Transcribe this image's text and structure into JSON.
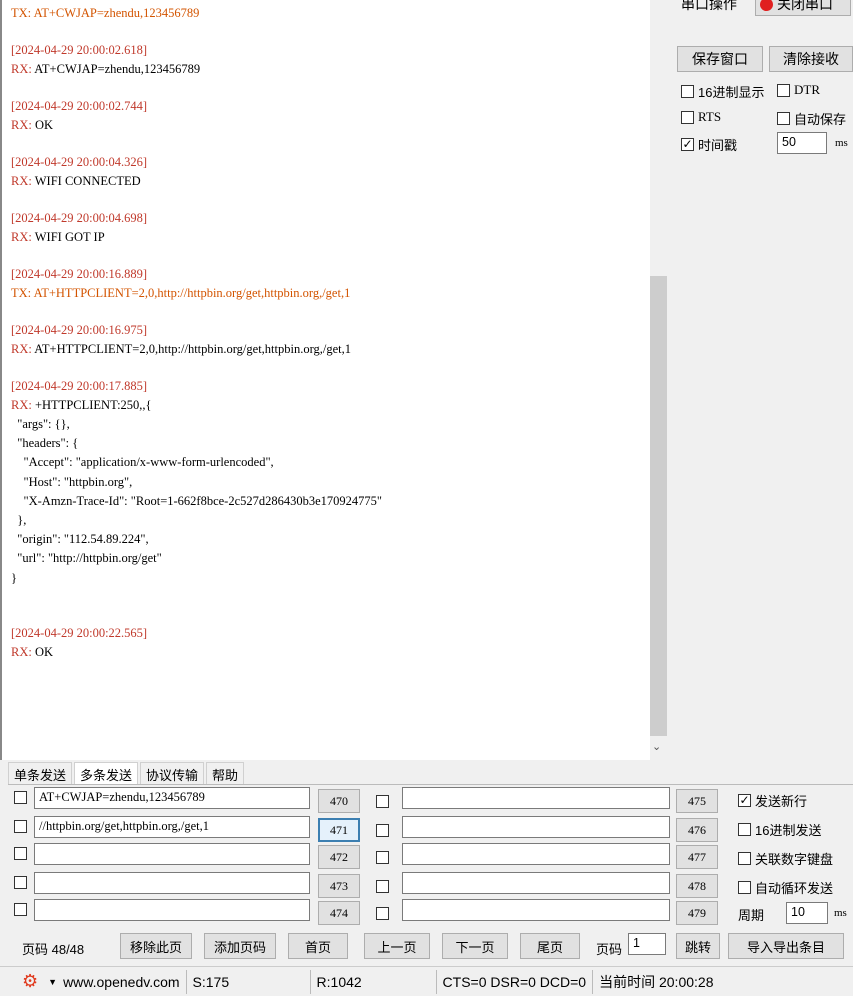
{
  "log": {
    "first_line": "TX: AT+CWJAP=zhendu,123456789",
    "entries": [
      {
        "ts": "[2024-04-29 20:00:02.618]",
        "prefix": "RX: ",
        "text": "AT+CWJAP=zhendu,123456789",
        "dir": "rx"
      },
      {
        "ts": "[2024-04-29 20:00:02.744]",
        "prefix": "RX: ",
        "text": "OK",
        "dir": "rx"
      },
      {
        "ts": "[2024-04-29 20:00:04.326]",
        "prefix": "RX: ",
        "text": "WIFI CONNECTED",
        "dir": "rx"
      },
      {
        "ts": "[2024-04-29 20:00:04.698]",
        "prefix": "RX: ",
        "text": "WIFI GOT IP",
        "dir": "rx"
      },
      {
        "ts": "[2024-04-29 20:00:16.889]",
        "prefix": "TX: ",
        "text": "AT+HTTPCLIENT=2,0,http://httpbin.org/get,httpbin.org,/get,1",
        "dir": "tx"
      },
      {
        "ts": "[2024-04-29 20:00:16.975]",
        "prefix": "RX: ",
        "text": "AT+HTTPCLIENT=2,0,http://httpbin.org/get,httpbin.org,/get,1",
        "dir": "rx"
      },
      {
        "ts": "[2024-04-29 20:00:17.885]",
        "prefix": "RX: ",
        "text": "+HTTPCLIENT:250,,{",
        "dir": "rx"
      },
      {
        "ts": "[2024-04-29 20:00:22.565]",
        "prefix": "RX: ",
        "text": "OK",
        "dir": "rx"
      }
    ],
    "json_body": "  \"args\": {},\n  \"headers\": {\n    \"Accept\": \"application/x-www-form-urlencoded\",\n    \"Host\": \"httpbin.org\",\n    \"X-Amzn-Trace-Id\": \"Root=1-662f8bce-2c527d286430b3e170924775\"\n  },\n  \"origin\": \"112.54.89.224\",\n  \"url\": \"http://httpbin.org/get\"\n}"
  },
  "right": {
    "port_op_label": "串口操作",
    "close_port_label": "关闭串口",
    "save_window": "保存窗口",
    "clear_recv": "清除接收",
    "hex_display": "16进制显示",
    "dtr": "DTR",
    "rts": "RTS",
    "auto_save": "自动保存",
    "timestamp": "时间戳",
    "timestamp_value": "50",
    "timestamp_unit": "ms"
  },
  "tabs": [
    "单条发送",
    "多条发送",
    "协议传输",
    "帮助"
  ],
  "multi": {
    "left_rows": [
      {
        "text": "AT+CWJAP=zhendu,123456789",
        "num": "470"
      },
      {
        "text": "//httpbin.org/get,httpbin.org,/get,1",
        "num": "471"
      },
      {
        "text": "",
        "num": "472"
      },
      {
        "text": "",
        "num": "473"
      },
      {
        "text": "",
        "num": "474"
      }
    ],
    "right_rows": [
      {
        "text": "",
        "num": "475"
      },
      {
        "text": "",
        "num": "476"
      },
      {
        "text": "",
        "num": "477"
      },
      {
        "text": "",
        "num": "478"
      },
      {
        "text": "",
        "num": "479"
      }
    ],
    "send_newline": "发送新行",
    "hex_send": "16进制发送",
    "link_keypad": "关联数字键盘",
    "auto_loop": "自动循环发送",
    "period_label": "周期",
    "period_value": "10",
    "period_unit": "ms"
  },
  "pager": {
    "page_info": "页码 48/48",
    "remove_page": "移除此页",
    "add_page": "添加页码",
    "first": "首页",
    "prev": "上一页",
    "next": "下一页",
    "last": "尾页",
    "page_label": "页码",
    "page_value": "1",
    "jump": "跳转",
    "import_export": "导入导出条目"
  },
  "status": {
    "url": "www.openedv.com",
    "sent": "S:175",
    "recv": "R:1042",
    "signals": "CTS=0 DSR=0 DCD=0",
    "time": "当前时间 20:00:28"
  }
}
